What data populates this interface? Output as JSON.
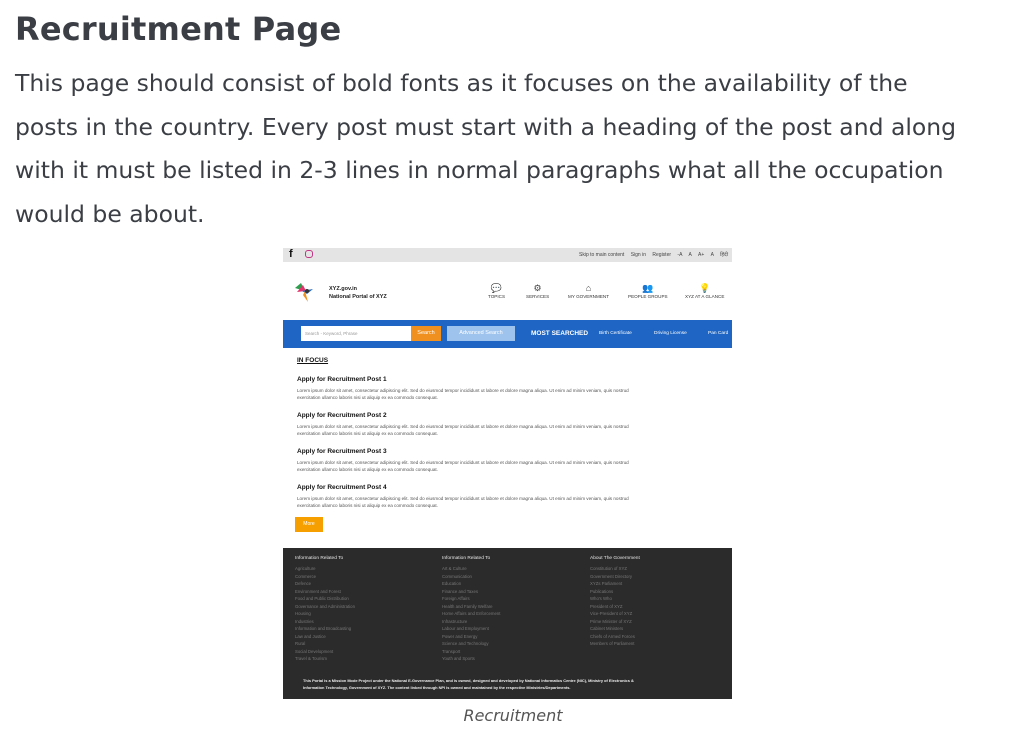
{
  "doc": {
    "title": "Recruitment Page",
    "paragraph_lines": [
      "This page should consist of bold fonts as it focuses on the availability of the",
      "posts in the country. Every post must start with a heading of the post and along",
      "with it must be listed in 2-3 lines in normal paragraphs what all the occupation",
      "would be about."
    ],
    "caption": "Recruitment"
  },
  "screenshot": {
    "topbar": {
      "facebook_icon": "f",
      "instagram_icon": "instagram-icon",
      "links": [
        "Skip to main content",
        "Sign in",
        "Register",
        "-A",
        "A",
        "A+",
        "A",
        "हिंदी"
      ]
    },
    "header": {
      "site_url": "XYZ.gov.in",
      "site_name": "National Portal of XYZ",
      "nav": [
        {
          "label": "TOPICS",
          "icon": "💬"
        },
        {
          "label": "SERVICES",
          "icon": "⚙"
        },
        {
          "label": "MY GOVERNMENT",
          "icon": "⌂"
        },
        {
          "label": "PEOPLE GROUPS",
          "icon": "👥"
        },
        {
          "label": "XYZ AT A GLANCE",
          "icon": "💡"
        }
      ]
    },
    "search": {
      "placeholder": "Search - Keyword, Phrase",
      "search_label": "Search",
      "advanced_label": "Advanced Search",
      "most_searched_label": "MOST SEARCHED",
      "most_searched_links": [
        "Birth Certificate",
        "Driving License",
        "Pan Card"
      ]
    },
    "main": {
      "section_title": "IN FOCUS",
      "posts": [
        {
          "heading": "Apply for Recruitment Post 1",
          "line1": "Lorem ipsum dolor sit amet, consectetur adipiscing elit. Sed do eiusmod tempor incididunt ut labore et dolore magna aliqua. Ut enim ad minim veniam, quis nostrud",
          "line2": "exercitation ullamco laboris nisi ut aliquip ex ea commodo consequat."
        },
        {
          "heading": "Apply for Recruitment Post 2",
          "line1": "Lorem ipsum dolor sit amet, consectetur adipiscing elit. Sed do eiusmod tempor incididunt ut labore et dolore magna aliqua. Ut enim ad minim veniam, quis nostrud",
          "line2": "exercitation ullamco laboris nisi ut aliquip ex ea commodo consequat."
        },
        {
          "heading": "Apply for Recruitment Post 3",
          "line1": "Lorem ipsum dolor sit amet, consectetur adipiscing elit. Sed do eiusmod tempor incididunt ut labore et dolore magna aliqua. Ut enim ad minim veniam, quis nostrud",
          "line2": "exercitation ullamco laboris nisi ut aliquip ex ea commodo consequat."
        },
        {
          "heading": "Apply for Recruitment Post 4",
          "line1": "Lorem ipsum dolor sit amet, consectetur adipiscing elit. Sed do eiusmod tempor incididunt ut labore et dolore magna aliqua. Ut enim ad minim veniam, quis nostrud",
          "line2": "exercitation ullamco laboris nisi ut aliquip ex ea commodo consequat."
        }
      ],
      "more_label": "More"
    },
    "footer": {
      "columns": [
        {
          "heading": "Information Related To",
          "items": [
            "Agriculture",
            "Commerce",
            "Defence",
            "Environment and Forest",
            "Food and Public Distribution",
            "Governance and Administration",
            "Housing",
            "Industries",
            "Information and Broadcasting",
            "Law and Justice",
            "Rural",
            "Social Development",
            "Travel & Tourism"
          ]
        },
        {
          "heading": "Information Related To",
          "items": [
            "Art & Culture",
            "Communication",
            "Education",
            "Finance and Taxes",
            "Foreign Affairs",
            "Health and Family Welfare",
            "Home Affairs and Enforcement",
            "Infrastructure",
            "Labour and Employment",
            "Power and Energy",
            "Science and Technology",
            "Transport",
            "Youth and Sports"
          ]
        },
        {
          "heading": "About The Government",
          "items": [
            "Constitution of XYZ",
            "Government Directory",
            "XYZs Parliament",
            "Publications",
            "Who's Who",
            "President of XYZ",
            "Vice-President of XYZ",
            "Prime Minister of XYZ",
            "Cabinet Ministers",
            "Chiefs of Armed Forces",
            "Members of Parliament"
          ]
        }
      ],
      "note_line1": "This Portal is a Mission Mode Project under the National E-Governance Plan, and is owned, designed and developed by National Informatics Centre (NIC), Ministry of Electronics &",
      "note_line2": "Information Technology, Government of XYZ. The content linked through NPI is owned and maintained by the respective Ministries/Departments."
    },
    "colors": {
      "search_bar": "#1f66c4",
      "search_button": "#f0901e",
      "more_button": "#f5a000",
      "footer_bg": "#2b2b2b"
    }
  }
}
